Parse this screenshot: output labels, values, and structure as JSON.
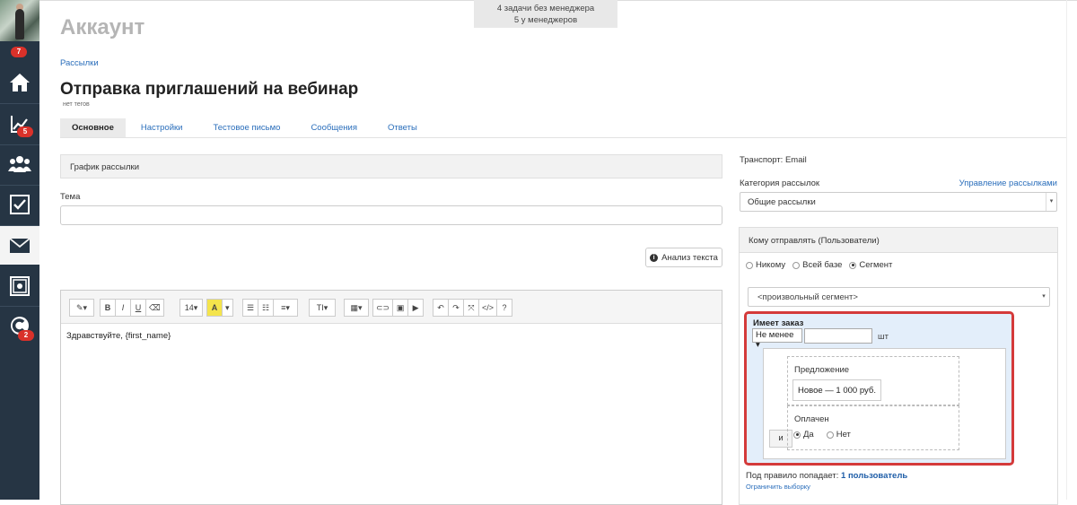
{
  "sidebar": {
    "avatar_badge": "7",
    "items": [
      {
        "name": "home",
        "badge": ""
      },
      {
        "name": "analytics",
        "badge": "5"
      },
      {
        "name": "users",
        "badge": ""
      },
      {
        "name": "tasks",
        "badge": ""
      },
      {
        "name": "mail",
        "badge": ""
      },
      {
        "name": "safe",
        "badge": ""
      },
      {
        "name": "chat",
        "badge": "2"
      }
    ]
  },
  "top_notice": {
    "line1": "4 задачи без менеджера",
    "line2": "5 у менеджеров"
  },
  "header": {
    "account_title": "Аккаунт",
    "breadcrumb": "Рассылки",
    "page_title": "Отправка приглашений на вебинар",
    "tags": "нет тегов"
  },
  "tabs": [
    "Основное",
    "Настройки",
    "Тестовое письмо",
    "Сообщения",
    "Ответы"
  ],
  "main": {
    "schedule_label": "График рассылки",
    "subject_label": "Тема",
    "subject_value": "",
    "analyze_button": "Анализ текста",
    "editor_content": "Здравствуйте, {first_name}",
    "toolbar": {
      "font_size": "14",
      "text_style": "T",
      "help": "?"
    }
  },
  "right": {
    "transport": "Транспорт: Email",
    "category_label": "Категория рассылок",
    "manage_link": "Управление рассылками",
    "category_value": "Общие рассылки",
    "recipients_title": "Кому отправлять (Пользователи)",
    "recipient_options": [
      "Никому",
      "Всей базе",
      "Сегмент"
    ],
    "recipient_selected": "Сегмент",
    "segment_value": "<произвольный сегмент>",
    "rule": {
      "title": "Имеет заказ",
      "operator": "Не менее",
      "quantity": "",
      "unit": "шт",
      "and_label": "и",
      "offer_label": "Предложение",
      "offer_value": "Новое — 1 000 руб.",
      "paid_label": "Оплачен",
      "paid_options": [
        "Да",
        "Нет"
      ],
      "paid_selected": "Да"
    },
    "rule_count_prefix": "Под правило попадает:",
    "rule_count_value": "1 пользователь",
    "limit_link": "Ограничить выборку"
  },
  "colors": {
    "sidebar_bg": "#263544",
    "badge": "#d9312a",
    "link": "#2a6ebb",
    "highlight_border": "#d43a3a",
    "rule_bg": "#e3eefa"
  }
}
